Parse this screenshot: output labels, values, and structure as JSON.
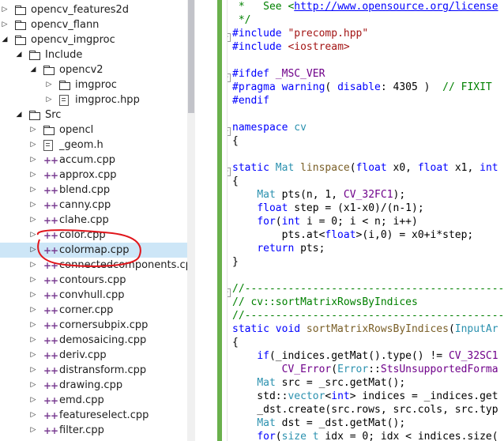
{
  "tree": {
    "items": [
      {
        "label": "opencv_features2d",
        "kind": "folder",
        "depth": 0,
        "expanded": false
      },
      {
        "label": "opencv_flann",
        "kind": "folder",
        "depth": 0,
        "expanded": false
      },
      {
        "label": "opencv_imgproc",
        "kind": "folder",
        "depth": 0,
        "expanded": true
      },
      {
        "label": "Include",
        "kind": "folder",
        "depth": 1,
        "expanded": true
      },
      {
        "label": "opencv2",
        "kind": "folder",
        "depth": 2,
        "expanded": true
      },
      {
        "label": "imgproc",
        "kind": "folder",
        "depth": 3,
        "expanded": false
      },
      {
        "label": "imgproc.hpp",
        "kind": "header",
        "depth": 3,
        "expanded": false
      },
      {
        "label": "Src",
        "kind": "folder",
        "depth": 1,
        "expanded": true
      },
      {
        "label": "opencl",
        "kind": "folder",
        "depth": 2,
        "expanded": false
      },
      {
        "label": "_geom.h",
        "kind": "header",
        "depth": 2,
        "expanded": false
      },
      {
        "label": "accum.cpp",
        "kind": "cpp",
        "depth": 2,
        "expanded": false
      },
      {
        "label": "approx.cpp",
        "kind": "cpp",
        "depth": 2,
        "expanded": false
      },
      {
        "label": "blend.cpp",
        "kind": "cpp",
        "depth": 2,
        "expanded": false
      },
      {
        "label": "canny.cpp",
        "kind": "cpp",
        "depth": 2,
        "expanded": false
      },
      {
        "label": "clahe.cpp",
        "kind": "cpp",
        "depth": 2,
        "expanded": false
      },
      {
        "label": "color.cpp",
        "kind": "cpp",
        "depth": 2,
        "expanded": false
      },
      {
        "label": "colormap.cpp",
        "kind": "cpp",
        "depth": 2,
        "expanded": false,
        "selected": true
      },
      {
        "label": "connectedcomponents.cpp",
        "kind": "cpp",
        "depth": 2,
        "expanded": false
      },
      {
        "label": "contours.cpp",
        "kind": "cpp",
        "depth": 2,
        "expanded": false
      },
      {
        "label": "convhull.cpp",
        "kind": "cpp",
        "depth": 2,
        "expanded": false
      },
      {
        "label": "corner.cpp",
        "kind": "cpp",
        "depth": 2,
        "expanded": false
      },
      {
        "label": "cornersubpix.cpp",
        "kind": "cpp",
        "depth": 2,
        "expanded": false
      },
      {
        "label": "demosaicing.cpp",
        "kind": "cpp",
        "depth": 2,
        "expanded": false
      },
      {
        "label": "deriv.cpp",
        "kind": "cpp",
        "depth": 2,
        "expanded": false
      },
      {
        "label": "distransform.cpp",
        "kind": "cpp",
        "depth": 2,
        "expanded": false
      },
      {
        "label": "drawing.cpp",
        "kind": "cpp",
        "depth": 2,
        "expanded": false
      },
      {
        "label": "emd.cpp",
        "kind": "cpp",
        "depth": 2,
        "expanded": false
      },
      {
        "label": "featureselect.cpp",
        "kind": "cpp",
        "depth": 2,
        "expanded": false
      },
      {
        "label": "filter.cpp",
        "kind": "cpp",
        "depth": 2,
        "expanded": false
      }
    ]
  },
  "editor": {
    "lines": [
      [
        [
          "cm",
          " *   See <"
        ],
        [
          "lnk",
          "http://www.opensource.org/license"
        ]
      ],
      [
        [
          "cm",
          " */"
        ]
      ],
      [
        [
          "pp",
          "#include "
        ],
        [
          "str",
          "\"precomp.hpp\""
        ]
      ],
      [
        [
          "pp",
          "#include "
        ],
        [
          "str",
          "<iostream>"
        ]
      ],
      [
        [
          "",
          ""
        ]
      ],
      [
        [
          "pp",
          "#ifdef "
        ],
        [
          "mac",
          "_MSC_VER"
        ]
      ],
      [
        [
          "pp",
          "#pragma warning"
        ],
        [
          "",
          "( "
        ],
        [
          "pp",
          "disable"
        ],
        [
          "",
          ": 4305 )  "
        ],
        [
          "cm",
          "// FIXIT"
        ]
      ],
      [
        [
          "pp",
          "#endif"
        ]
      ],
      [
        [
          "",
          ""
        ]
      ],
      [
        [
          "kw",
          "namespace "
        ],
        [
          "ty",
          "cv"
        ]
      ],
      [
        [
          "",
          "{"
        ]
      ],
      [
        [
          "",
          ""
        ]
      ],
      [
        [
          "kw",
          "static "
        ],
        [
          "ty",
          "Mat "
        ],
        [
          "fn",
          "linspace"
        ],
        [
          "",
          "("
        ],
        [
          "kw",
          "float "
        ],
        [
          "",
          "x0, "
        ],
        [
          "kw",
          "float "
        ],
        [
          "",
          "x1, "
        ],
        [
          "kw",
          "int"
        ]
      ],
      [
        [
          "",
          "{"
        ]
      ],
      [
        [
          "",
          "    "
        ],
        [
          "ty",
          "Mat "
        ],
        [
          "",
          "pts(n, 1, "
        ],
        [
          "mac",
          "CV_32FC1"
        ],
        [
          "",
          ");"
        ]
      ],
      [
        [
          "",
          "    "
        ],
        [
          "kw",
          "float "
        ],
        [
          "",
          "step = (x1-x0)/(n-1);"
        ]
      ],
      [
        [
          "",
          "    "
        ],
        [
          "kw",
          "for"
        ],
        [
          "",
          "("
        ],
        [
          "kw",
          "int "
        ],
        [
          "",
          "i = 0; i < n; i++)"
        ]
      ],
      [
        [
          "",
          "        pts.at<"
        ],
        [
          "kw",
          "float"
        ],
        [
          "",
          ">(i,0) = x0+i*step;"
        ]
      ],
      [
        [
          "",
          "    "
        ],
        [
          "kw",
          "return "
        ],
        [
          "",
          "pts;"
        ]
      ],
      [
        [
          "",
          "}"
        ]
      ],
      [
        [
          "",
          ""
        ]
      ],
      [
        [
          "cm",
          "//-------------------------------------------"
        ]
      ],
      [
        [
          "cm",
          "// cv::sortMatrixRowsByIndices"
        ]
      ],
      [
        [
          "cm",
          "//-------------------------------------------"
        ]
      ],
      [
        [
          "kw",
          "static void "
        ],
        [
          "fn",
          "sortMatrixRowsByIndices"
        ],
        [
          "",
          "("
        ],
        [
          "ty",
          "InputAr"
        ]
      ],
      [
        [
          "",
          "{"
        ]
      ],
      [
        [
          "",
          "    "
        ],
        [
          "kw",
          "if"
        ],
        [
          "",
          "(_indices.getMat().type() != "
        ],
        [
          "mac",
          "CV_32SC1"
        ]
      ],
      [
        [
          "",
          "        "
        ],
        [
          "mac",
          "CV_Error"
        ],
        [
          "",
          "("
        ],
        [
          "ty",
          "Error"
        ],
        [
          "",
          "::"
        ],
        [
          "mac",
          "StsUnsupportedForma"
        ]
      ],
      [
        [
          "",
          "    "
        ],
        [
          "ty",
          "Mat "
        ],
        [
          "",
          "src = _src.getMat();"
        ]
      ],
      [
        [
          "",
          "    std::"
        ],
        [
          "ty",
          "vector"
        ],
        [
          "",
          "<"
        ],
        [
          "kw",
          "int"
        ],
        [
          "",
          "> indices = _indices.get"
        ]
      ],
      [
        [
          "",
          "    _dst.create(src.rows, src.cols, src.typ"
        ]
      ],
      [
        [
          "",
          "    "
        ],
        [
          "ty",
          "Mat "
        ],
        [
          "",
          "dst = _dst.getMat();"
        ]
      ],
      [
        [
          "",
          "    "
        ],
        [
          "kw",
          "for"
        ],
        [
          "",
          "("
        ],
        [
          "ty",
          "size_t "
        ],
        [
          "",
          "idx = 0; idx < indices.size("
        ]
      ]
    ]
  },
  "colors": {
    "selection": "#cde6f7",
    "annotation": "#e0151b",
    "keyword": "#0000ff",
    "comment": "#008000",
    "string": "#a31515",
    "type": "#2b91af"
  }
}
